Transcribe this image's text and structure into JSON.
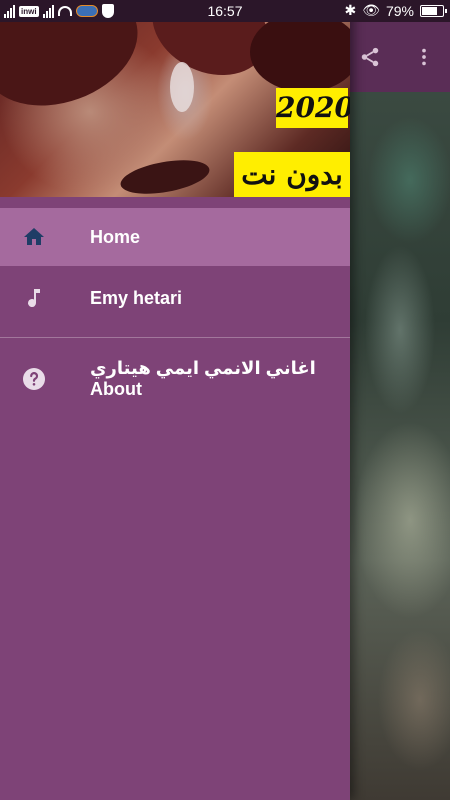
{
  "status_bar": {
    "operator": "inwi",
    "time": "16:57",
    "battery": "79%",
    "battery_level": 0.79
  },
  "toolbar": {
    "share_icon": "share-icon",
    "more_icon": "more-vert-icon"
  },
  "drawer": {
    "header": {
      "year_label": "2020",
      "offline_label": "بدون نت"
    },
    "items": [
      {
        "label": "Home",
        "icon": "home-icon",
        "selected": true
      },
      {
        "label": "Emy hetari",
        "icon": "music-note-icon",
        "selected": false
      },
      {
        "label": "اغاني الانمي ايمي هيتاري About",
        "icon": "help-icon",
        "selected": false
      }
    ]
  },
  "colors": {
    "drawer_bg": "#7e4377",
    "selected_bg": "#a56a9e",
    "toolbar": "#5a2d56",
    "home_icon": "#1f3d66",
    "label_bg": "#ffee00"
  }
}
